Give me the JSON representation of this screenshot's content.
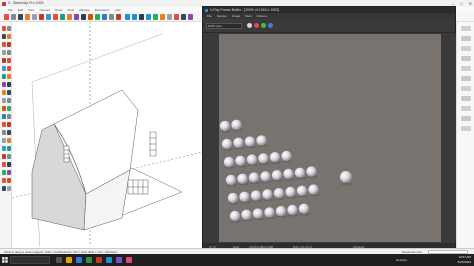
{
  "window": {
    "title": "3 - SketchUp Pro 2023",
    "controls": [
      "–",
      "□",
      "✕"
    ]
  },
  "menu": {
    "items": [
      "File",
      "Edit",
      "View",
      "Camera",
      "Draw",
      "Tools",
      "Window",
      "Extensions",
      "Help"
    ]
  },
  "vfb": {
    "title": "V-Ray Frame Buffer - [100% of 1044 x 1053]",
    "menu": [
      "File",
      "Render",
      "Image",
      "View",
      "Options"
    ],
    "channel": "RGB color",
    "status_left": "[0, 0]",
    "status_mid1": "Raw",
    "status_mid2": "0.000 0.000 0.000",
    "status_mid3": "HSV 0 0.0 0.0",
    "status_right": "Finished"
  },
  "statusbar": {
    "message": "Click or drag to select objects. Shift = Add/Subtract. Ctrl = Add. Shift + Ctrl = Subtract.",
    "measurements_label": "Measurements"
  },
  "taskbar": {
    "desktop_label": "Desktop",
    "time": "10:57 AM",
    "date": "5/25/2023"
  },
  "colors": {
    "vfb_bg": "#79736f",
    "sketchup_accent": "#c0392b",
    "vray_accent": "#1f8fd6"
  }
}
